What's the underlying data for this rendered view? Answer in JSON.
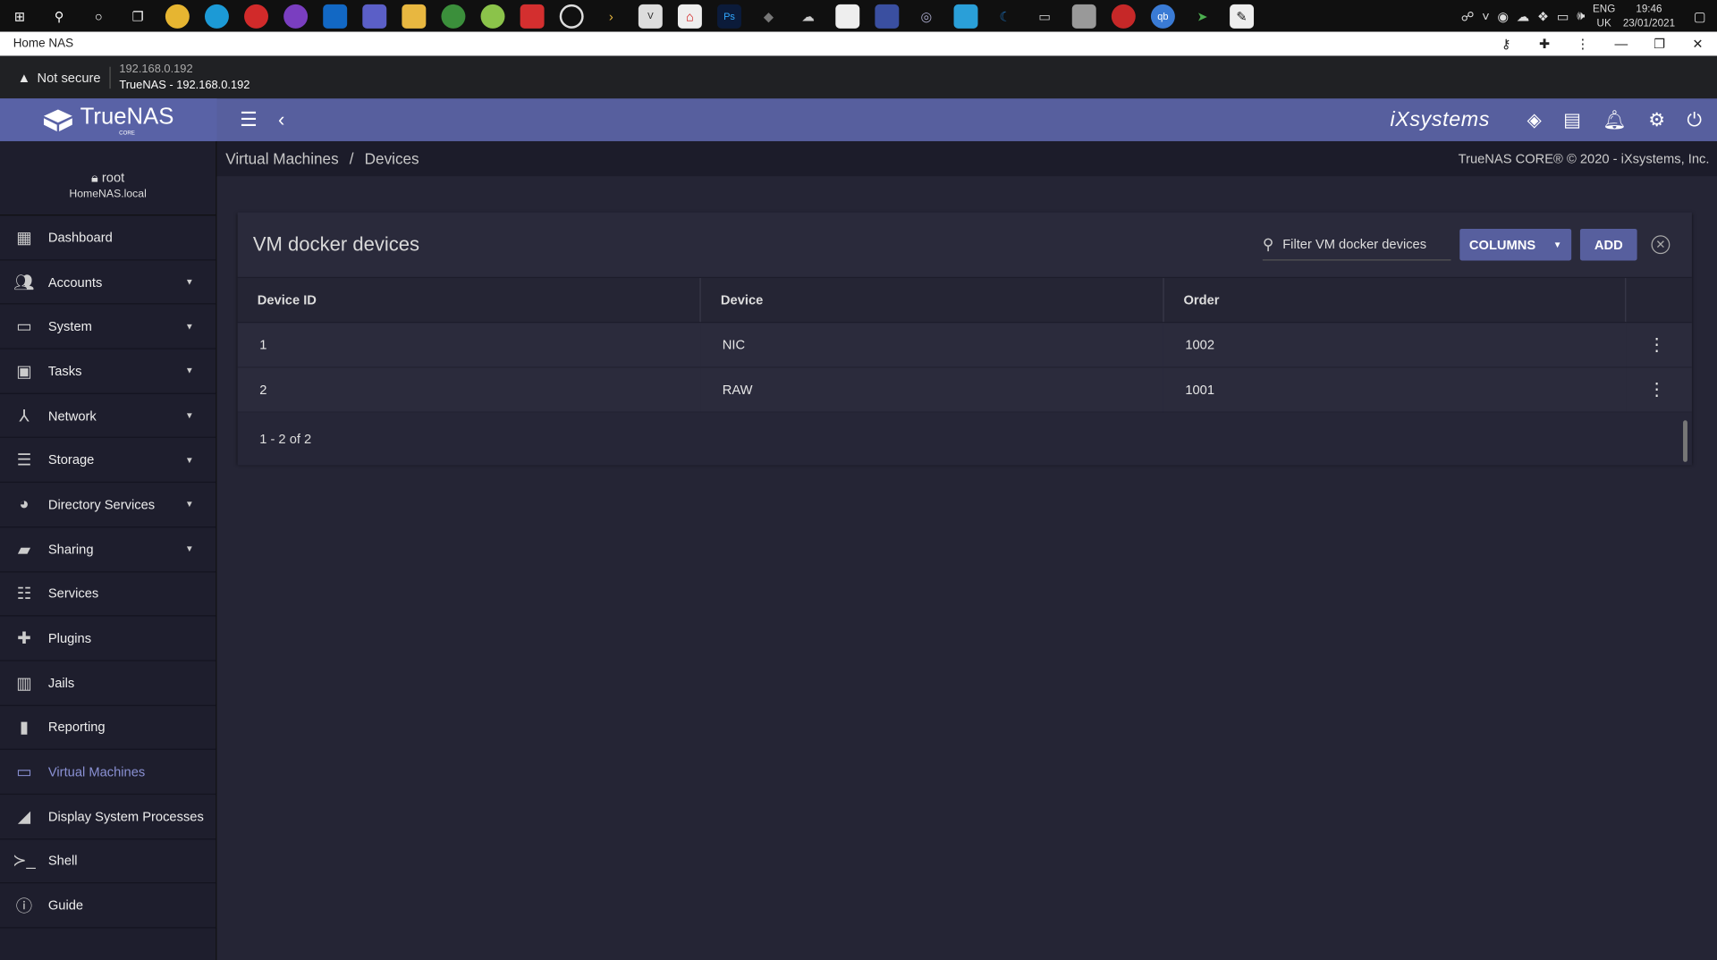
{
  "os": {
    "taskbar_icons": [
      "windows-icon",
      "search-icon",
      "cortana-icon",
      "task-view-icon",
      "chrome-icon",
      "edge-icon",
      "opera-icon",
      "podcast-icon",
      "outlook-icon",
      "teams-icon",
      "file-explorer-icon",
      "app-icon",
      "app-icon",
      "app-icon",
      "1password-icon",
      "app-icon",
      "vnc-icon",
      "acrobat-icon",
      "photoshop-icon",
      "app-icon",
      "app-icon",
      "store-icon",
      "app-icon",
      "app-icon",
      "app-icon",
      "app-icon",
      "app-icon",
      "calculator-icon",
      "app-icon",
      "qbittorrent-icon",
      "app-icon",
      "terminal-icon"
    ],
    "lang": "ENG",
    "region": "UK",
    "time": "19:46",
    "date": "23/01/2021"
  },
  "browser": {
    "window_title": "Home NAS",
    "security_label": "Not secure",
    "address_host": "192.168.0.192",
    "page_title": "TrueNAS - 192.168.0.192"
  },
  "topbar": {
    "brand": "TrueNAS",
    "brand_sub": "CORE",
    "partner": "iXsystems"
  },
  "user": {
    "name": "root",
    "host": "HomeNAS.local"
  },
  "sidebar": {
    "items": [
      {
        "label": "Dashboard"
      },
      {
        "label": "Accounts"
      },
      {
        "label": "System"
      },
      {
        "label": "Tasks"
      },
      {
        "label": "Network"
      },
      {
        "label": "Storage"
      },
      {
        "label": "Directory Services"
      },
      {
        "label": "Sharing"
      },
      {
        "label": "Services"
      },
      {
        "label": "Plugins"
      },
      {
        "label": "Jails"
      },
      {
        "label": "Reporting"
      },
      {
        "label": "Virtual Machines"
      },
      {
        "label": "Display System Processes"
      },
      {
        "label": "Shell"
      },
      {
        "label": "Guide"
      }
    ],
    "active": "Virtual Machines"
  },
  "breadcrumb": {
    "parent": "Virtual Machines",
    "separator": "/",
    "current": "Devices",
    "copyright": "TrueNAS CORE® © 2020 - iXsystems, Inc."
  },
  "card": {
    "title": "VM docker devices",
    "filter_placeholder": "Filter VM docker devices",
    "columns_label": "COLUMNS",
    "add_label": "ADD",
    "headers": [
      "Device ID",
      "Device",
      "Order"
    ],
    "rows": [
      {
        "id": "1",
        "device": "NIC",
        "order": "1002"
      },
      {
        "id": "2",
        "device": "RAW",
        "order": "1001"
      }
    ],
    "pagination": "1 - 2 of 2"
  },
  "colors": {
    "accent": "#575f9e",
    "active_nav": "#8a91d4",
    "background": "#1e1e2d"
  }
}
